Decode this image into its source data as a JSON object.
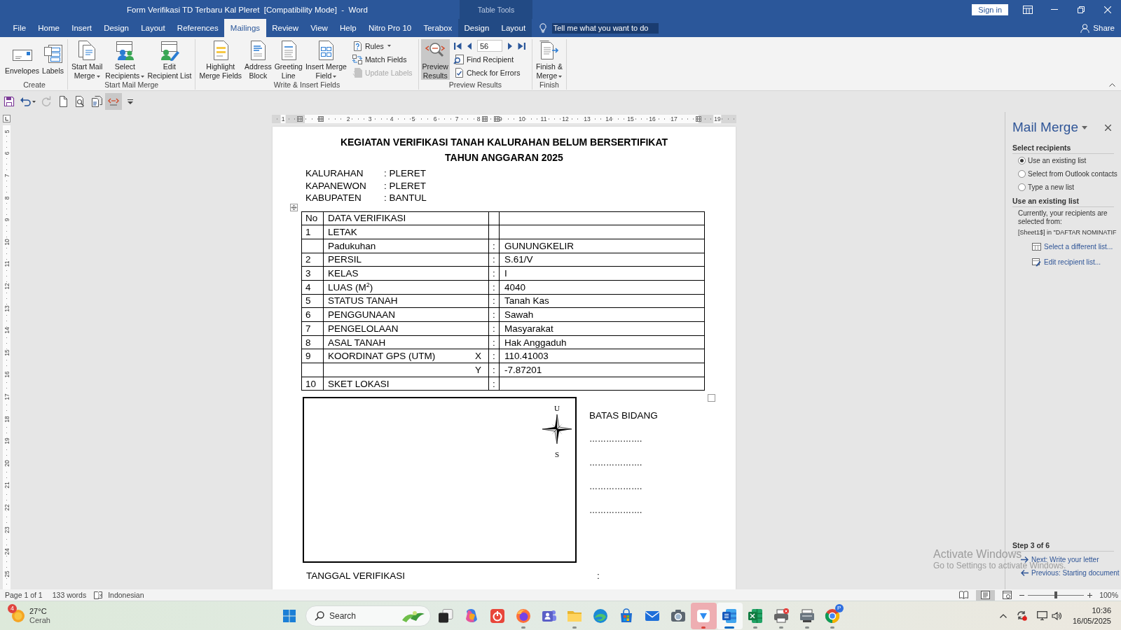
{
  "window": {
    "title": "Form Verifikasi TD Terbaru Kal Pleret  [Compatibility Mode]  -  Word",
    "context_label": "Table Tools",
    "sign_in": "Sign in"
  },
  "ribbon_tabs": [
    {
      "label": "File",
      "kind": "plain",
      "selected": false
    },
    {
      "label": "Home",
      "kind": "plain",
      "selected": false
    },
    {
      "label": "Insert",
      "kind": "plain",
      "selected": false
    },
    {
      "label": "Design",
      "kind": "plain",
      "selected": false
    },
    {
      "label": "Layout",
      "kind": "plain",
      "selected": false
    },
    {
      "label": "References",
      "kind": "plain",
      "selected": false
    },
    {
      "label": "Mailings",
      "kind": "plain",
      "selected": true
    },
    {
      "label": "Review",
      "kind": "plain",
      "selected": false
    },
    {
      "label": "View",
      "kind": "plain",
      "selected": false
    },
    {
      "label": "Help",
      "kind": "plain",
      "selected": false
    },
    {
      "label": "Nitro Pro 10",
      "kind": "plain",
      "selected": false
    },
    {
      "label": "Terabox",
      "kind": "plain",
      "selected": false
    },
    {
      "label": "Design",
      "kind": "contextual",
      "selected": false
    },
    {
      "label": "Layout",
      "kind": "contextual",
      "selected": false
    }
  ],
  "tell_me": {
    "placeholder": "Tell me what you want to do"
  },
  "share": "Share",
  "ribbon_groups": [
    {
      "label": "Create",
      "items": [
        {
          "kind": "large",
          "label": "Envelopes",
          "dropdown": false,
          "pressed": false
        },
        {
          "kind": "large",
          "label": "Labels",
          "dropdown": false,
          "pressed": false
        }
      ]
    },
    {
      "label": "Start Mail Merge",
      "items": [
        {
          "kind": "large",
          "label": "Start Mail\nMerge",
          "dropdown": true,
          "pressed": false
        },
        {
          "kind": "large",
          "label": "Select\nRecipients",
          "dropdown": true,
          "pressed": false
        },
        {
          "kind": "large",
          "label": "Edit\nRecipient List",
          "dropdown": false,
          "pressed": false
        }
      ]
    },
    {
      "label": "Write & Insert Fields",
      "items": [
        {
          "kind": "large",
          "label": "Highlight\nMerge Fields",
          "dropdown": false,
          "pressed": false
        },
        {
          "kind": "large",
          "label": "Address\nBlock",
          "dropdown": false,
          "pressed": false
        },
        {
          "kind": "large",
          "label": "Greeting\nLine",
          "dropdown": false,
          "pressed": false
        },
        {
          "kind": "large",
          "label": "Insert Merge\nField",
          "dropdown": true,
          "pressed": false
        },
        {
          "kind": "stack",
          "items": [
            {
              "kind": "small",
              "label": "Rules",
              "dropdown": true,
              "disabled": false
            },
            {
              "kind": "small",
              "label": "Match Fields",
              "dropdown": false,
              "disabled": false
            },
            {
              "kind": "small",
              "label": "Update Labels",
              "dropdown": false,
              "disabled": true
            }
          ]
        }
      ]
    },
    {
      "label": "Preview Results",
      "items": [
        {
          "kind": "large",
          "label": "Preview\nResults",
          "dropdown": false,
          "pressed": true
        },
        {
          "kind": "stack",
          "items": [
            {
              "kind": "navigator",
              "value": "56"
            },
            {
              "kind": "small",
              "label": "Find Recipient",
              "dropdown": false,
              "disabled": false
            },
            {
              "kind": "small",
              "label": "Check for Errors",
              "dropdown": false,
              "disabled": false
            }
          ]
        }
      ]
    },
    {
      "label": "Finish",
      "items": [
        {
          "kind": "large",
          "label": "Finish &\nMerge",
          "dropdown": true,
          "pressed": false
        }
      ]
    }
  ],
  "quick_access": [
    {
      "kind": "save",
      "disabled": false,
      "pressed": false
    },
    {
      "kind": "undo",
      "disabled": false,
      "pressed": false
    },
    {
      "kind": "redo",
      "disabled": true,
      "pressed": false
    },
    {
      "kind": "new",
      "disabled": false,
      "pressed": false
    },
    {
      "kind": "preview",
      "disabled": false,
      "pressed": false
    },
    {
      "kind": "pages",
      "disabled": false,
      "pressed": false
    },
    {
      "kind": "spelling",
      "disabled": false,
      "pressed": true
    },
    {
      "kind": "customize",
      "disabled": false,
      "pressed": false
    }
  ],
  "horizontal_ruler": {
    "numbers": [
      "1",
      "2",
      "3",
      "4",
      "5",
      "6",
      "7",
      "8",
      "9",
      "10",
      "11",
      "12",
      "13",
      "14",
      "15",
      "16",
      "17",
      "19"
    ]
  },
  "vertical_ruler": {
    "numbers": [
      "5",
      "6",
      "7",
      "8",
      "9",
      "10",
      "11",
      "12",
      "13",
      "14",
      "15",
      "16",
      "17",
      "18",
      "19",
      "20",
      "21",
      "22",
      "23",
      "24",
      "25"
    ]
  },
  "document": {
    "title_lines": [
      "KEGIATAN VERIFIKASI TANAH KALURAHAN BELUM BERSERTIFIKAT",
      "TAHUN ANGGARAN 2025"
    ],
    "location": [
      {
        "label": "KALURAHAN",
        "value": ": PLERET"
      },
      {
        "label": "KAPANEWON",
        "value": ": PLERET"
      },
      {
        "label": "KABUPATEN",
        "value": ": BANTUL"
      }
    ],
    "table": {
      "columns": [
        "No",
        "DATA VERIFIKASI"
      ],
      "rows": [
        {
          "no": "1",
          "field": "LETAK"
        },
        {
          "field": "Padukuhan",
          "colon": ":",
          "value": "GUNUNGKELIR"
        },
        {
          "no": "2",
          "field": "PERSIL",
          "colon": ":",
          "value": "S.61/V"
        },
        {
          "no": "3",
          "field": "KELAS",
          "colon": ":",
          "value": "I"
        },
        {
          "no": "4",
          "field": "LUAS (M$^{2}$)",
          "colon": ":",
          "value": "4040"
        },
        {
          "no": "5",
          "field": "STATUS TANAH",
          "colon": ":",
          "value": "Tanah Kas"
        },
        {
          "no": "6",
          "field": "PENGGUNAAN",
          "colon": ":",
          "value": "Sawah"
        },
        {
          "no": "7",
          "field": "PENGELOLAAN",
          "colon": ":",
          "value": "Masyarakat"
        },
        {
          "no": "8",
          "field": "ASAL TANAH",
          "colon": ":",
          "value": "Hak Anggaduh"
        },
        {
          "no": "9",
          "field": "KOORDINAT GPS (UTM)",
          "axis": "X",
          "colon": ":",
          "value": "110.41003"
        },
        {
          "axis": "Y",
          "colon": ":",
          "value": "-7.87201"
        },
        {
          "no": "10",
          "field": "SKET LOKASI",
          "colon": ":"
        }
      ]
    },
    "sketch": {
      "north": "U",
      "south": "S"
    },
    "boundaries": {
      "heading": "BATAS BIDANG",
      "blanks": [
        "……………….",
        "……………….",
        "……………….",
        "………………."
      ]
    },
    "fields": [
      {
        "label": "TANGGAL VERIFIKASI",
        "colon": ":"
      }
    ]
  },
  "mail_merge_pane": {
    "title": "Mail Merge",
    "recipients": {
      "heading": "Select recipients",
      "options": [
        {
          "label": "Use an existing list",
          "selected": true
        },
        {
          "label": "Select from Outlook contacts",
          "selected": false
        },
        {
          "label": "Type a new list",
          "selected": false
        }
      ]
    },
    "existing": {
      "heading": "Use an existing list",
      "description": "Currently, your recipients are selected from:",
      "source": "[Sheet1$] in \"DAFTAR NOMINATIF",
      "links": [
        "Select a different list...",
        "Edit recipient list..."
      ]
    },
    "step": "Step 3 of 6",
    "nav": [
      {
        "kind": "next",
        "label": "Next: Write your letter"
      },
      {
        "kind": "previous",
        "label": "Previous: Starting document"
      }
    ]
  },
  "activation_notice": {
    "title": "Activate Windows",
    "message": "Go to Settings to activate Windows."
  },
  "status_bar": {
    "page": "Page 1 of 1",
    "words": "133 words",
    "language": "Indonesian",
    "views": [
      {
        "kind": "read",
        "selected": false
      },
      {
        "kind": "print",
        "selected": true
      },
      {
        "kind": "web",
        "selected": false
      }
    ],
    "zoom": {
      "level": 0.5,
      "label": "100%"
    }
  },
  "taskbar": {
    "weather": {
      "badge": "4",
      "temperature": "27°C",
      "condition": "Cerah"
    },
    "search": {
      "placeholder": "Search"
    },
    "apps": [
      {
        "kind": "desktop",
        "running": false,
        "active": false,
        "flashing": false
      },
      {
        "kind": "assistant",
        "running": false,
        "active": false,
        "flashing": false
      },
      {
        "kind": "reminder",
        "running": false,
        "active": false,
        "flashing": false
      },
      {
        "kind": "browser",
        "running": true,
        "active": false,
        "flashing": false
      },
      {
        "kind": "chat",
        "running": false,
        "active": false,
        "flashing": false
      },
      {
        "kind": "folder",
        "running": true,
        "active": false,
        "flashing": false
      },
      {
        "kind": "web",
        "running": false,
        "active": false,
        "flashing": false
      },
      {
        "kind": "store",
        "running": false,
        "active": false,
        "flashing": false
      },
      {
        "kind": "mail",
        "running": false,
        "active": false,
        "flashing": false
      },
      {
        "kind": "camera",
        "running": false,
        "active": false,
        "flashing": false
      },
      {
        "kind": "cloud",
        "running": true,
        "active": false,
        "flashing": true
      },
      {
        "kind": "writer",
        "running": true,
        "active": true,
        "flashing": false
      },
      {
        "kind": "sheet",
        "running": true,
        "active": false,
        "flashing": false
      },
      {
        "kind": "printer",
        "running": true,
        "active": false,
        "flashing": false
      },
      {
        "kind": "scanner",
        "running": true,
        "active": false,
        "flashing": false
      },
      {
        "kind": "globe",
        "running": true,
        "active": false,
        "flashing": false,
        "badge": "P"
      }
    ],
    "clock": {
      "time": "10:36",
      "date": "16/05/2025"
    }
  }
}
